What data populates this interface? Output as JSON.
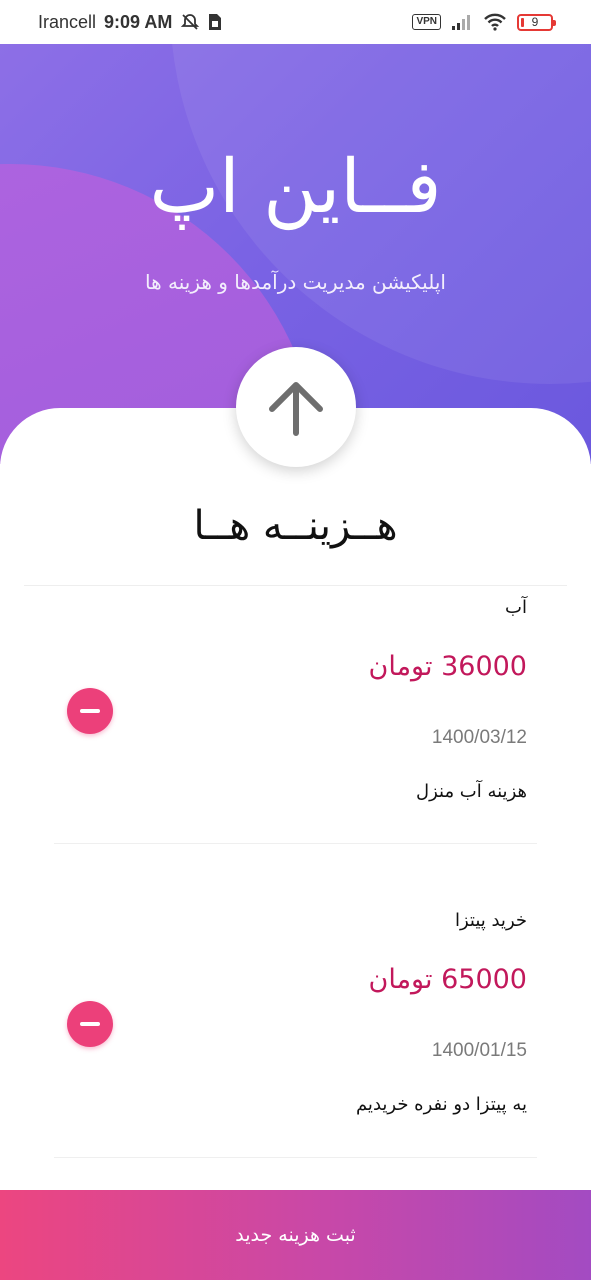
{
  "status_bar": {
    "carrier": "Irancell",
    "time": "9:09 AM",
    "vpn": "VPN",
    "battery_level": "9",
    "battery_fraction": 0.09,
    "battery_color": "#e53935"
  },
  "header": {
    "title": "فــاین اپ",
    "subtitle": "اپلیکیشن مدیریت درآمدها و هزینه ها",
    "up_icon": "arrow-up-icon",
    "colors": {
      "primary": "#7a63e4",
      "accent_blob": "#a55edc"
    }
  },
  "section": {
    "title": "هــزینــه هــا"
  },
  "expenses": [
    {
      "title": "آب",
      "amount": "36000 تومان",
      "date": "1400/03/12",
      "description": "هزینه آب منزل",
      "remove_icon": "minus-icon"
    },
    {
      "title": "خرید پیتزا",
      "amount": "65000 تومان",
      "date": "1400/01/15",
      "description": "یه پیتزا دو نفره خریدیم",
      "remove_icon": "minus-icon"
    }
  ],
  "colors": {
    "amount": "#c2185b",
    "remove_button": "#ec407a",
    "button_start": "#ec4680",
    "button_end": "#a34bc2"
  },
  "actions": {
    "add_expense_label": "ثبت هزینه جدید"
  }
}
